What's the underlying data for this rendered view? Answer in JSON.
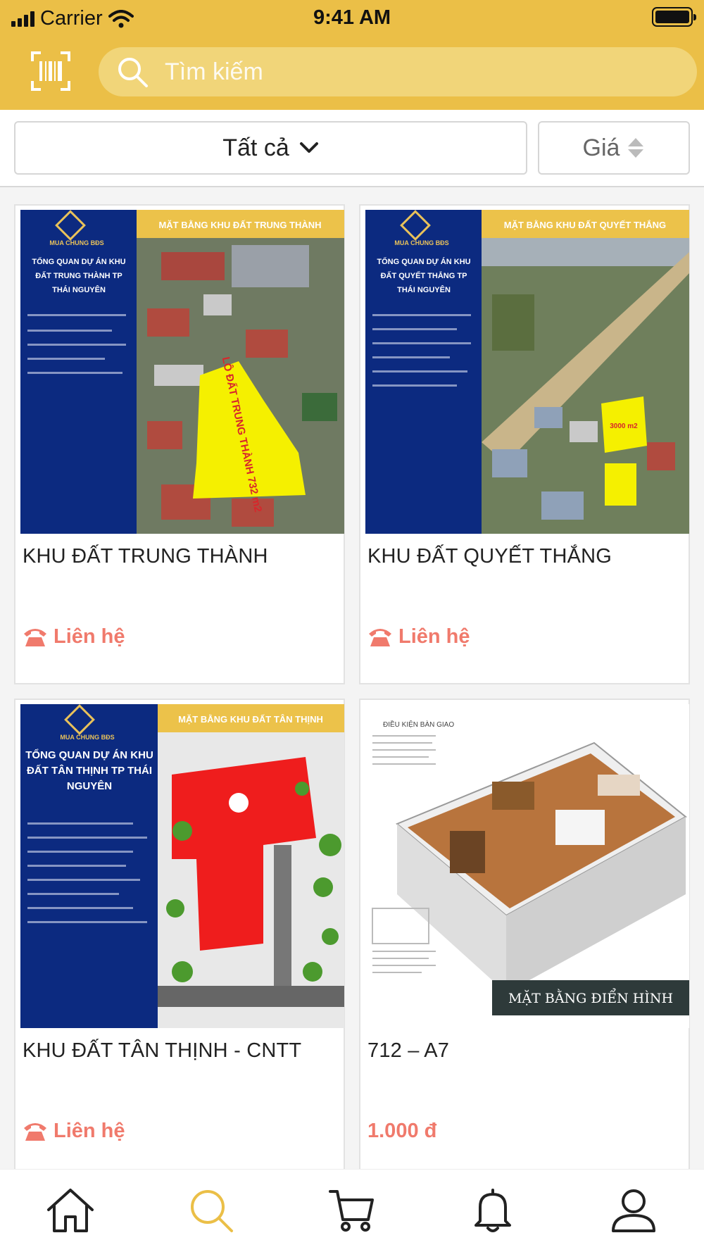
{
  "status_bar": {
    "carrier": "Carrier",
    "time": "9:41 AM"
  },
  "header": {
    "search_placeholder": "Tìm kiếm"
  },
  "filters": {
    "category_label": "Tất cả",
    "sort_label": "Giá"
  },
  "products": [
    {
      "title": "KHU ĐẤT TRUNG THÀNH",
      "price": "Liên hệ",
      "image": {
        "brand": "MUA CHUNG BĐS",
        "banner": "MẶT BẰNG KHU ĐẤT TRUNG THÀNH",
        "heading": "TỔNG QUAN DỰ ÁN KHU ĐẤT TRUNG THÀNH TP THÁI NGUYÊN",
        "plot_label": "LÔ ĐẤT TRUNG THÀNH 732 m2"
      }
    },
    {
      "title": "KHU ĐẤT QUYẾT THẮNG",
      "price": "Liên hệ",
      "image": {
        "brand": "MUA CHUNG BĐS",
        "banner": "MẶT BẰNG KHU ĐẤT QUYẾT THẮNG",
        "heading": "TỔNG QUAN DỰ ÁN KHU ĐẤT QUYẾT THẮNG TP THÁI NGUYÊN",
        "plot_label": "3000 m2"
      }
    },
    {
      "title": "KHU ĐẤT TÂN THỊNH - CNTT",
      "price": "Liên hệ",
      "image": {
        "brand": "MUA CHUNG BĐS",
        "banner": "MẶT BẰNG KHU ĐẤT TÂN THỊNH",
        "heading": "TỔNG QUAN DỰ ÁN KHU ĐẤT TÂN THỊNH TP THÁI NGUYÊN"
      }
    },
    {
      "title": "712 – A7",
      "price": "1.000 đ",
      "image": {
        "heading": "ĐIỀU KIỆN BÀN GIAO",
        "caption": "MẶT BẰNG ĐIỂN HÌNH"
      }
    }
  ],
  "tabs": [
    "home",
    "search",
    "cart",
    "notifications",
    "profile"
  ],
  "colors": {
    "brand_yellow": "#ebbf47",
    "price_red": "#f07a6c",
    "poster_navy": "#0c2a80"
  }
}
